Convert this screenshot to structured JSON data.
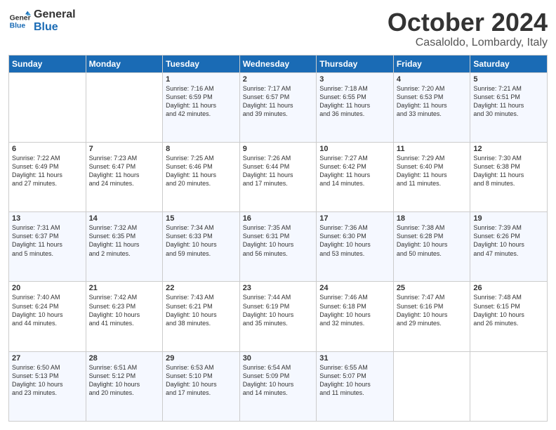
{
  "logo": {
    "line1": "General",
    "line2": "Blue"
  },
  "title": "October 2024",
  "subtitle": "Casaloldo, Lombardy, Italy",
  "header_days": [
    "Sunday",
    "Monday",
    "Tuesday",
    "Wednesday",
    "Thursday",
    "Friday",
    "Saturday"
  ],
  "weeks": [
    [
      {
        "day": "",
        "text": ""
      },
      {
        "day": "",
        "text": ""
      },
      {
        "day": "1",
        "text": "Sunrise: 7:16 AM\nSunset: 6:59 PM\nDaylight: 11 hours\nand 42 minutes."
      },
      {
        "day": "2",
        "text": "Sunrise: 7:17 AM\nSunset: 6:57 PM\nDaylight: 11 hours\nand 39 minutes."
      },
      {
        "day": "3",
        "text": "Sunrise: 7:18 AM\nSunset: 6:55 PM\nDaylight: 11 hours\nand 36 minutes."
      },
      {
        "day": "4",
        "text": "Sunrise: 7:20 AM\nSunset: 6:53 PM\nDaylight: 11 hours\nand 33 minutes."
      },
      {
        "day": "5",
        "text": "Sunrise: 7:21 AM\nSunset: 6:51 PM\nDaylight: 11 hours\nand 30 minutes."
      }
    ],
    [
      {
        "day": "6",
        "text": "Sunrise: 7:22 AM\nSunset: 6:49 PM\nDaylight: 11 hours\nand 27 minutes."
      },
      {
        "day": "7",
        "text": "Sunrise: 7:23 AM\nSunset: 6:47 PM\nDaylight: 11 hours\nand 24 minutes."
      },
      {
        "day": "8",
        "text": "Sunrise: 7:25 AM\nSunset: 6:46 PM\nDaylight: 11 hours\nand 20 minutes."
      },
      {
        "day": "9",
        "text": "Sunrise: 7:26 AM\nSunset: 6:44 PM\nDaylight: 11 hours\nand 17 minutes."
      },
      {
        "day": "10",
        "text": "Sunrise: 7:27 AM\nSunset: 6:42 PM\nDaylight: 11 hours\nand 14 minutes."
      },
      {
        "day": "11",
        "text": "Sunrise: 7:29 AM\nSunset: 6:40 PM\nDaylight: 11 hours\nand 11 minutes."
      },
      {
        "day": "12",
        "text": "Sunrise: 7:30 AM\nSunset: 6:38 PM\nDaylight: 11 hours\nand 8 minutes."
      }
    ],
    [
      {
        "day": "13",
        "text": "Sunrise: 7:31 AM\nSunset: 6:37 PM\nDaylight: 11 hours\nand 5 minutes."
      },
      {
        "day": "14",
        "text": "Sunrise: 7:32 AM\nSunset: 6:35 PM\nDaylight: 11 hours\nand 2 minutes."
      },
      {
        "day": "15",
        "text": "Sunrise: 7:34 AM\nSunset: 6:33 PM\nDaylight: 10 hours\nand 59 minutes."
      },
      {
        "day": "16",
        "text": "Sunrise: 7:35 AM\nSunset: 6:31 PM\nDaylight: 10 hours\nand 56 minutes."
      },
      {
        "day": "17",
        "text": "Sunrise: 7:36 AM\nSunset: 6:30 PM\nDaylight: 10 hours\nand 53 minutes."
      },
      {
        "day": "18",
        "text": "Sunrise: 7:38 AM\nSunset: 6:28 PM\nDaylight: 10 hours\nand 50 minutes."
      },
      {
        "day": "19",
        "text": "Sunrise: 7:39 AM\nSunset: 6:26 PM\nDaylight: 10 hours\nand 47 minutes."
      }
    ],
    [
      {
        "day": "20",
        "text": "Sunrise: 7:40 AM\nSunset: 6:24 PM\nDaylight: 10 hours\nand 44 minutes."
      },
      {
        "day": "21",
        "text": "Sunrise: 7:42 AM\nSunset: 6:23 PM\nDaylight: 10 hours\nand 41 minutes."
      },
      {
        "day": "22",
        "text": "Sunrise: 7:43 AM\nSunset: 6:21 PM\nDaylight: 10 hours\nand 38 minutes."
      },
      {
        "day": "23",
        "text": "Sunrise: 7:44 AM\nSunset: 6:19 PM\nDaylight: 10 hours\nand 35 minutes."
      },
      {
        "day": "24",
        "text": "Sunrise: 7:46 AM\nSunset: 6:18 PM\nDaylight: 10 hours\nand 32 minutes."
      },
      {
        "day": "25",
        "text": "Sunrise: 7:47 AM\nSunset: 6:16 PM\nDaylight: 10 hours\nand 29 minutes."
      },
      {
        "day": "26",
        "text": "Sunrise: 7:48 AM\nSunset: 6:15 PM\nDaylight: 10 hours\nand 26 minutes."
      }
    ],
    [
      {
        "day": "27",
        "text": "Sunrise: 6:50 AM\nSunset: 5:13 PM\nDaylight: 10 hours\nand 23 minutes."
      },
      {
        "day": "28",
        "text": "Sunrise: 6:51 AM\nSunset: 5:12 PM\nDaylight: 10 hours\nand 20 minutes."
      },
      {
        "day": "29",
        "text": "Sunrise: 6:53 AM\nSunset: 5:10 PM\nDaylight: 10 hours\nand 17 minutes."
      },
      {
        "day": "30",
        "text": "Sunrise: 6:54 AM\nSunset: 5:09 PM\nDaylight: 10 hours\nand 14 minutes."
      },
      {
        "day": "31",
        "text": "Sunrise: 6:55 AM\nSunset: 5:07 PM\nDaylight: 10 hours\nand 11 minutes."
      },
      {
        "day": "",
        "text": ""
      },
      {
        "day": "",
        "text": ""
      }
    ]
  ]
}
